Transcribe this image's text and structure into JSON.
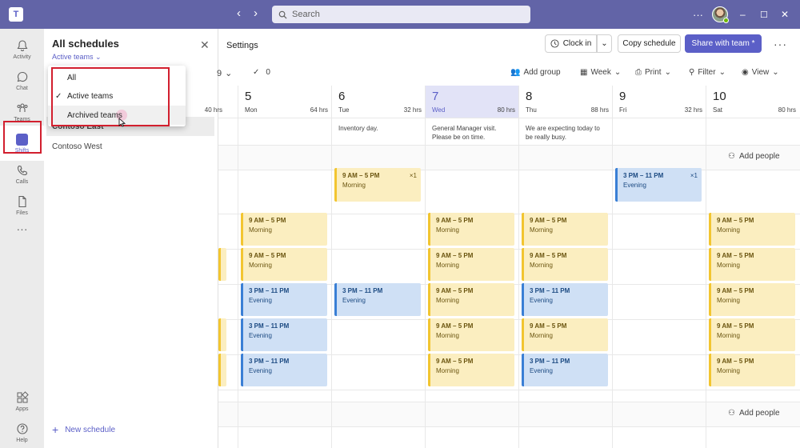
{
  "titlebar": {
    "logo": "T",
    "search_placeholder": "Search",
    "more": "···",
    "minimize": "–",
    "maximize": "☐",
    "close": "✕"
  },
  "rail": [
    {
      "label": "Activity",
      "icon": "bell-icon"
    },
    {
      "label": "Chat",
      "icon": "chat-icon"
    },
    {
      "label": "Teams",
      "icon": "teams-icon"
    },
    {
      "label": "Shifts",
      "icon": "shifts-icon"
    },
    {
      "label": "Calls",
      "icon": "phone-icon"
    },
    {
      "label": "Files",
      "icon": "file-icon"
    },
    {
      "label": "···",
      "icon": "more-icon"
    },
    {
      "label": "Apps",
      "icon": "apps-icon"
    },
    {
      "label": "Help",
      "icon": "help-icon"
    }
  ],
  "panel": {
    "title": "All schedules",
    "filter": "Active teams",
    "teams": [
      "Contoso East",
      "Contoso West"
    ],
    "new_schedule": "New schedule"
  },
  "dropdown": {
    "items": [
      "All",
      "Active teams",
      "Archived teams"
    ],
    "checked": "Active teams"
  },
  "toolbar": {
    "settings": "Settings",
    "clock_in": "Clock in",
    "copy_schedule": "Copy schedule",
    "share": "Share with team *",
    "date_range_end": "9",
    "check_count": "0",
    "add_group": "Add group",
    "week": "Week",
    "print": "Print",
    "filter": "Filter",
    "view": "View"
  },
  "days": [
    {
      "num": "",
      "name": "",
      "hrs": "40 hrs",
      "note": ""
    },
    {
      "num": "5",
      "name": "Mon",
      "hrs": "64 hrs",
      "note": ""
    },
    {
      "num": "6",
      "name": "Tue",
      "hrs": "32 hrs",
      "note": "Inventory day."
    },
    {
      "num": "7",
      "name": "Wed",
      "hrs": "80 hrs",
      "note": "General Manager visit. Please be on time."
    },
    {
      "num": "8",
      "name": "Thu",
      "hrs": "88 hrs",
      "note": "We are expecting today to be really busy."
    },
    {
      "num": "9",
      "name": "Fri",
      "hrs": "32 hrs",
      "note": ""
    },
    {
      "num": "10",
      "name": "Sat",
      "hrs": "80 hrs",
      "note": ""
    }
  ],
  "today_index": 3,
  "add_people": "Add people",
  "shift_labels": {
    "morning_time": "9 AM – 5 PM",
    "morning_name": "Morning",
    "evening_time": "3 PM – 11 PM",
    "evening_name": "Evening",
    "count": "×1"
  },
  "shifts": [
    {
      "row": 0,
      "col": 2,
      "type": "morning",
      "count": true
    },
    {
      "row": 0,
      "col": 5,
      "type": "evening",
      "count": true
    },
    {
      "row": 1,
      "col": 1,
      "type": "morning"
    },
    {
      "row": 1,
      "col": 3,
      "type": "morning"
    },
    {
      "row": 1,
      "col": 4,
      "type": "morning"
    },
    {
      "row": 1,
      "col": 6,
      "type": "morning"
    },
    {
      "row": 2,
      "col": 0,
      "type": "morning"
    },
    {
      "row": 2,
      "col": 1,
      "type": "morning"
    },
    {
      "row": 2,
      "col": 3,
      "type": "morning"
    },
    {
      "row": 2,
      "col": 4,
      "type": "morning"
    },
    {
      "row": 2,
      "col": 6,
      "type": "morning"
    },
    {
      "row": 3,
      "col": 1,
      "type": "evening"
    },
    {
      "row": 3,
      "col": 2,
      "type": "evening"
    },
    {
      "row": 3,
      "col": 3,
      "type": "morning"
    },
    {
      "row": 3,
      "col": 4,
      "type": "evening"
    },
    {
      "row": 3,
      "col": 6,
      "type": "morning"
    },
    {
      "row": 4,
      "col": 0,
      "type": "morning"
    },
    {
      "row": 4,
      "col": 1,
      "type": "evening"
    },
    {
      "row": 4,
      "col": 3,
      "type": "morning"
    },
    {
      "row": 4,
      "col": 4,
      "type": "morning"
    },
    {
      "row": 4,
      "col": 6,
      "type": "morning"
    },
    {
      "row": 5,
      "col": 0,
      "type": "morning"
    },
    {
      "row": 5,
      "col": 1,
      "type": "evening"
    },
    {
      "row": 5,
      "col": 3,
      "type": "morning"
    },
    {
      "row": 5,
      "col": 4,
      "type": "evening"
    },
    {
      "row": 5,
      "col": 6,
      "type": "morning"
    }
  ],
  "colors": {
    "brand": "#6264a7",
    "accent": "#5b5fc7",
    "highlight": "#d21f2e",
    "morning": "#fbeec0",
    "evening": "#cfe0f5"
  }
}
